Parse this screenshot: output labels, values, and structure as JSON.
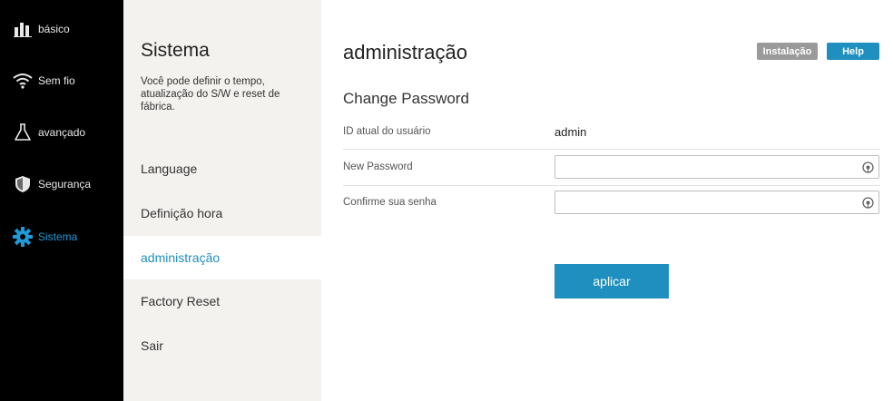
{
  "nav": {
    "items": [
      {
        "label": "básico",
        "icon": "bar-chart-icon"
      },
      {
        "label": "Sem fio",
        "icon": "wifi-icon"
      },
      {
        "label": "avançado",
        "icon": "flask-icon"
      },
      {
        "label": "Segurança",
        "icon": "shield-icon"
      },
      {
        "label": "Sistema",
        "icon": "gear-icon",
        "active": true
      }
    ]
  },
  "subnav": {
    "title": "Sistema",
    "description": "Você pode definir o tempo, atualização do S/W e reset de fábrica.",
    "items": [
      {
        "label": "Language"
      },
      {
        "label": "Definição hora"
      },
      {
        "label": "administração",
        "active": true
      },
      {
        "label": "Factory Reset"
      },
      {
        "label": "Sair"
      }
    ]
  },
  "main": {
    "title": "administração",
    "buttons": {
      "install": "Instalação",
      "help": "Help"
    },
    "section_title": "Change Password",
    "fields": {
      "user_id_label": "ID atual do usuário",
      "user_id_value": "admin",
      "new_password_label": "New Password",
      "new_password_value": "",
      "confirm_label": "Confirme sua senha",
      "confirm_value": ""
    },
    "apply_label": "aplicar"
  },
  "colors": {
    "accent": "#1e8fbf",
    "nav_bg": "#000000",
    "subnav_bg": "#f3f2ef",
    "install_button": "#9a9a9a"
  }
}
